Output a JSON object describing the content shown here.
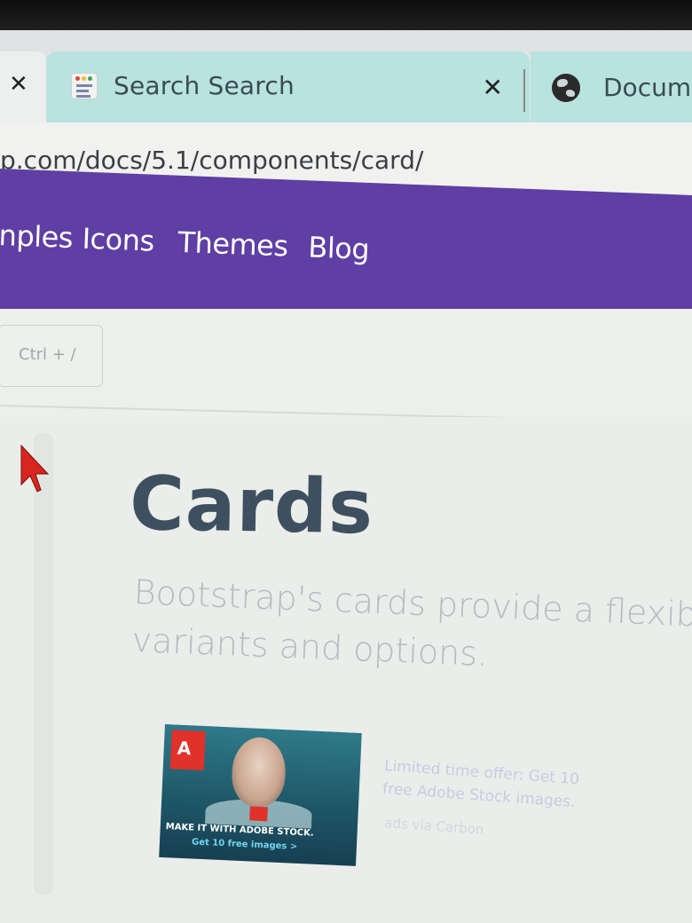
{
  "browser": {
    "tabs": [
      {
        "title": "Search Search",
        "active": true
      },
      {
        "title": "Docume",
        "active": false
      }
    ],
    "url": "p.com/docs/5.1/components/card/"
  },
  "navbar": {
    "items": [
      "nples",
      "Icons",
      "Themes",
      "Blog"
    ],
    "color": "#5f3fa4"
  },
  "search": {
    "shortcut": "Ctrl + /"
  },
  "page": {
    "title": "Cards",
    "lead_line1": "Bootstrap's cards provide a flexibl",
    "lead_line2": "variants and options."
  },
  "ad": {
    "logo": "A",
    "line1": "MAKE IT WITH ADOBE STOCK.",
    "line2": "Get 10 free images >",
    "text_line1": "Limited time offer: Get 10",
    "text_line2": "free Adobe Stock images.",
    "via": "ads via Carbon"
  },
  "icons": {
    "close": "close-icon",
    "favicon": "search-favicon-icon",
    "globe": "globe-icon",
    "cursor": "mouse-pointer-icon"
  }
}
